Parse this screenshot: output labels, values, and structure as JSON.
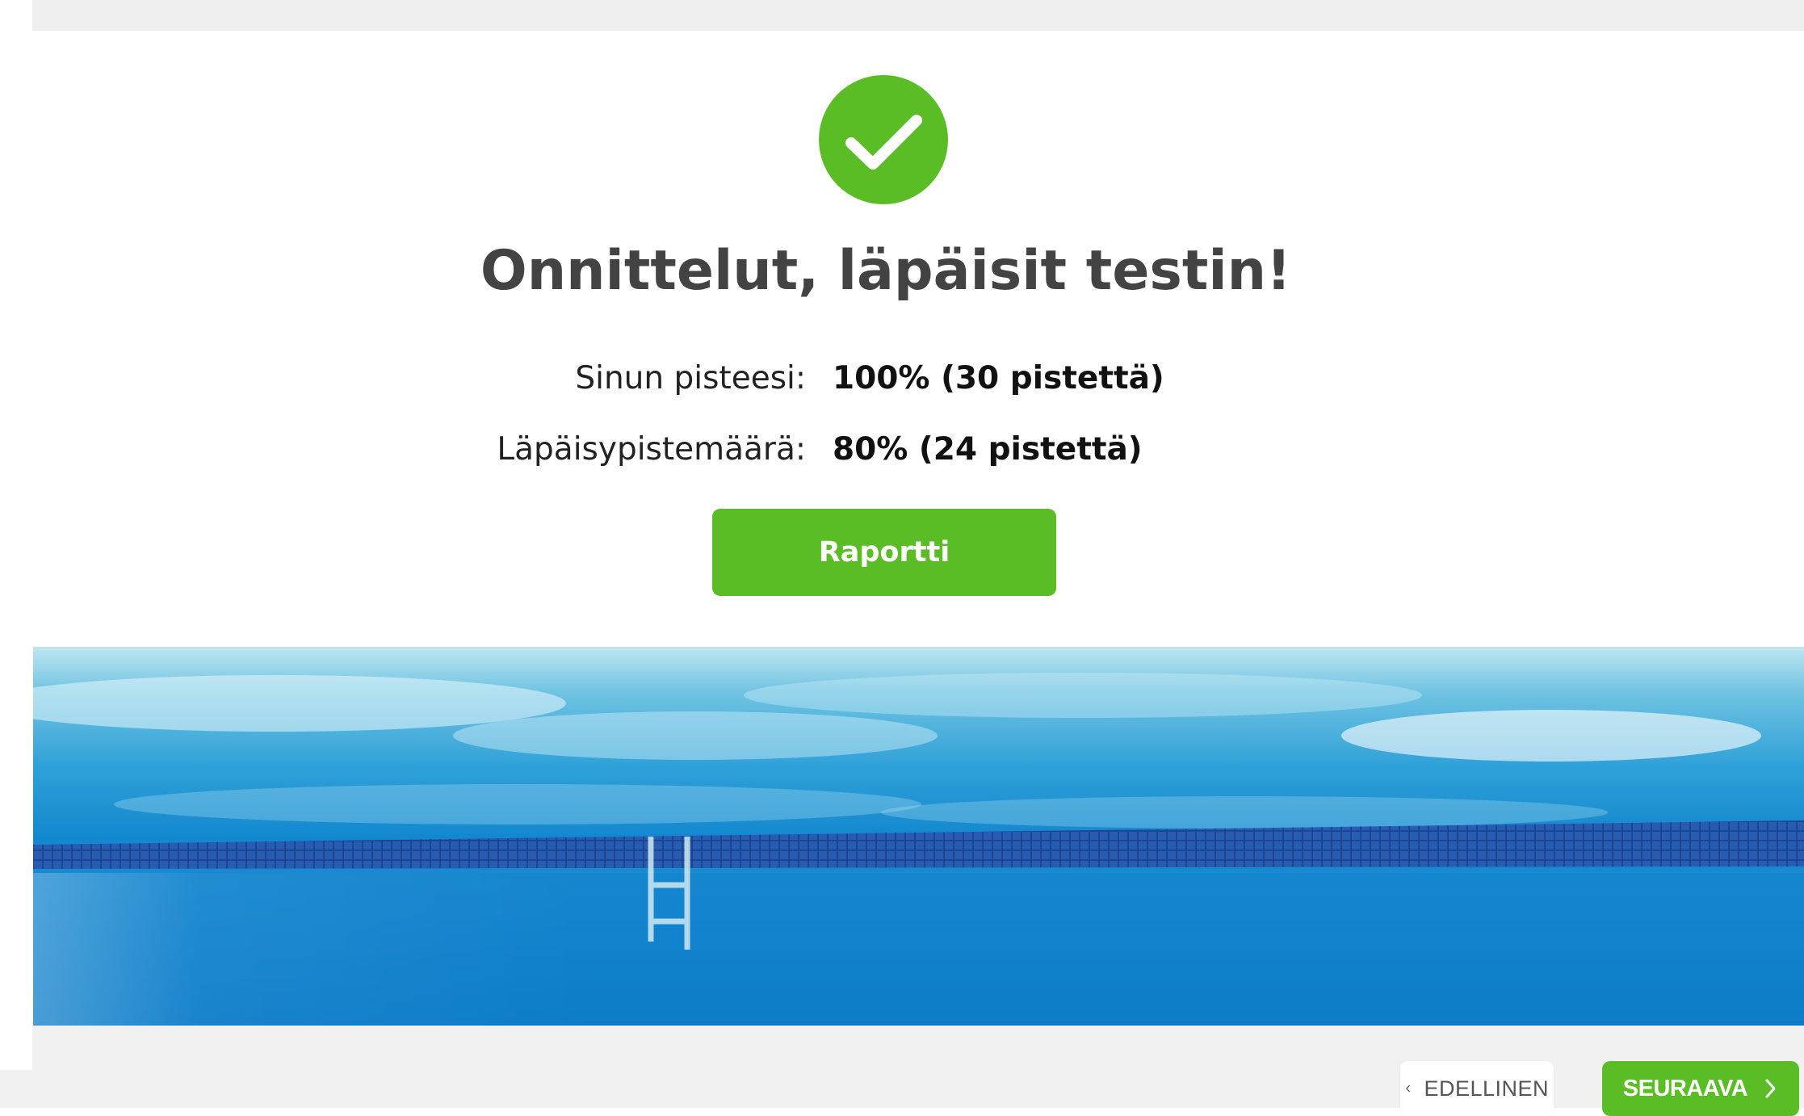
{
  "result": {
    "title": "Onnittelut, läpäisit testin!",
    "score_label": "Sinun pisteesi:",
    "score_value": "100% (30 pistettä)",
    "pass_label": "Läpäisypistemäärä:",
    "pass_value": "80% (24 pistettä)",
    "report_button": "Raportti"
  },
  "navigation": {
    "prev_label": "EDELLINEN",
    "next_label": "SEURAAVA"
  },
  "colors": {
    "accent_green": "#5bbd25",
    "heading_text": "#434343",
    "pool_blue": "#0a84cc"
  },
  "icons": {
    "success": "checkmark-circle-icon",
    "prev": "chevron-left-icon",
    "next": "chevron-right-icon"
  }
}
